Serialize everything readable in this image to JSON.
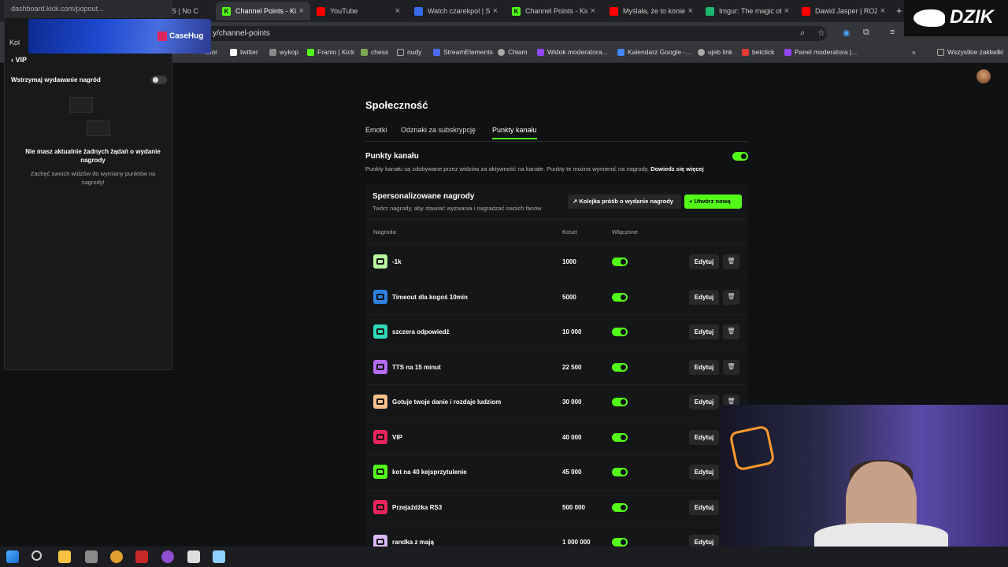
{
  "browser": {
    "tabs": [
      {
        "title": "S | No C",
        "icon_color": "#53fc18"
      },
      {
        "title": "Channel Points - Kick",
        "icon_color": "#53fc18",
        "active": true
      },
      {
        "title": "YouTube",
        "icon_color": "#ff0000"
      },
      {
        "title": "Watch czarekpol | St",
        "icon_color": "#3a6cf0"
      },
      {
        "title": "Channel Points - Kick",
        "icon_color": "#53fc18"
      },
      {
        "title": "Myślała, że to koniec",
        "icon_color": "#ff0000"
      },
      {
        "title": "Imgur: The magic of",
        "icon_color": "#1bb76e"
      },
      {
        "title": "Dawid Jasper | ROZM",
        "icon_color": "#ff0000"
      }
    ],
    "new_tab": "+",
    "url": "y/channel-points",
    "bookmarks": [
      {
        "label": "alior",
        "color": "#c62828"
      },
      {
        "label": "twitter",
        "color": "#ffffff"
      },
      {
        "label": "wykop",
        "color": "#888888"
      },
      {
        "label": "Franio | Kick",
        "color": "#53fc18"
      },
      {
        "label": "chess",
        "color": "#7fa650"
      },
      {
        "label": "nudy",
        "color": "#999999"
      },
      {
        "label": "StreamElements",
        "color": "#4b6bff"
      },
      {
        "label": "Chłam",
        "color": "#aaaaaa"
      },
      {
        "label": "Widok moderatora...",
        "color": "#9146ff"
      },
      {
        "label": "Kalendarz Google -...",
        "color": "#4285f4"
      },
      {
        "label": "ujeb link",
        "color": "#aaaaaa"
      },
      {
        "label": "betclick",
        "color": "#e53935"
      },
      {
        "label": "Panel moderatora |...",
        "color": "#9146ff"
      }
    ],
    "all_bookmarks": "Wszystkie zakładki"
  },
  "overlay": {
    "brand": "DZIK",
    "casehug": "CaseHug"
  },
  "popout": {
    "url": "dashboard.kick.com/popout...",
    "back_label": "VIP",
    "kick_prefix": "Kol",
    "pause_label": "Wstrzymaj wydawanie nagród",
    "empty_title": "Nie masz aktualnie żadnych żądań o wydanie nagrody",
    "empty_hint": "Zachęć swoich widzów do wymiany punktów na nagrody!"
  },
  "page": {
    "title": "Społeczność",
    "tabs": [
      "Emotki",
      "Odznaki za subskrypcję",
      "Punkty kanału"
    ],
    "section_title": "Punkty kanału",
    "section_desc": "Punkty kanału są zdobywane przez widzów za aktywność na kanale. Punkty te można wymienić na nagrody.",
    "learn_more": "Dowiedz się więcej",
    "rewards_title": "Spersonalizowane nagrody",
    "rewards_sub": "Twórz nagrody, aby stawiać wyzwania i nagradzać swoich fanów",
    "queue_button": "Kolejka próśb o wydanie nagrody",
    "new_button": "Utwórz nową",
    "columns": {
      "reward": "Nagroda",
      "cost": "Koszt",
      "enabled": "Włączone"
    },
    "edit_label": "Edytuj",
    "rewards": [
      {
        "name": "-1k",
        "cost": "1000",
        "color": "#b7f5a0"
      },
      {
        "name": "Timeout dla kogoś 10min",
        "cost": "5000",
        "color": "#2f7fe0"
      },
      {
        "name": "szczera odpowiedź",
        "cost": "10 000",
        "color": "#2ed8b6"
      },
      {
        "name": "TTS na 15 minut",
        "cost": "22 500",
        "color": "#b36cf2"
      },
      {
        "name": "Gotuje twoje danie i rozdaje ludziom",
        "cost": "30 000",
        "color": "#f6c08a"
      },
      {
        "name": "VIP",
        "cost": "40 000",
        "color": "#e8245c"
      },
      {
        "name": "kot na 40 kejsprzytulenie",
        "cost": "45 000",
        "color": "#53fc18"
      },
      {
        "name": "Przejażdżka RS3",
        "cost": "500 000",
        "color": "#e8245c"
      },
      {
        "name": "randka z mają",
        "cost": "1 000 000",
        "color": "#d8b8f8"
      }
    ]
  },
  "colors": {
    "accent": "#53fc18",
    "bg": "#0f1112"
  }
}
